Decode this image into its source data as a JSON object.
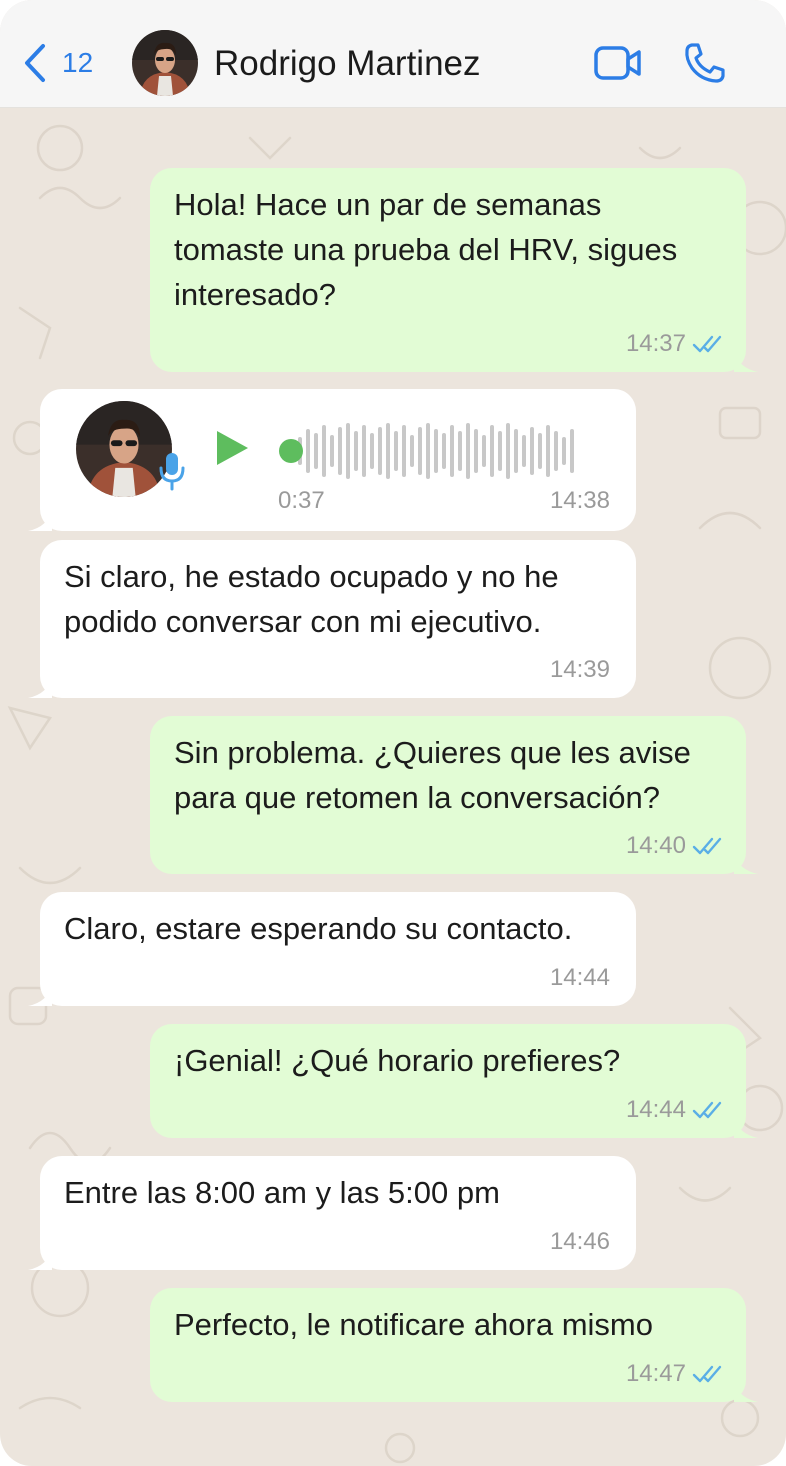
{
  "header": {
    "back_count": "12",
    "contact_name": "Rodrigo Martinez",
    "accent_color": "#2c7de6"
  },
  "colors": {
    "outgoing_bubble": "#e2fcd5",
    "incoming_bubble": "#ffffff",
    "chat_background": "#ece5dd",
    "read_ticks": "#5aaee6",
    "voice_green": "#5ebd5e"
  },
  "messages": [
    {
      "direction": "outgoing",
      "lines": [
        "Hola! Hace un par de semanas",
        "tomaste una prueba del HRV, sigues",
        "interesado?"
      ],
      "time": "14:37",
      "status_icon": "double-check-icon"
    },
    {
      "direction": "incoming",
      "type": "voice",
      "duration": "0:37",
      "time": "14:38",
      "icons": [
        "avatar",
        "microphone-icon",
        "play-icon",
        "waveform"
      ]
    },
    {
      "direction": "incoming",
      "lines": [
        "Si claro, he estado ocupado y no he",
        "podido conversar con mi ejecutivo."
      ],
      "time": "14:39"
    },
    {
      "direction": "outgoing",
      "lines": [
        "Sin problema. ¿Quieres que les avise",
        "para que retomen la conversación?"
      ],
      "time": "14:40",
      "status_icon": "double-check-icon"
    },
    {
      "direction": "incoming",
      "lines": [
        "Claro, estare esperando su contacto."
      ],
      "time": "14:44"
    },
    {
      "direction": "outgoing",
      "lines": [
        "¡Genial! ¿Qué horario prefieres?"
      ],
      "time": "14:44",
      "status_icon": "double-check-icon"
    },
    {
      "direction": "incoming",
      "lines": [
        "Entre las 8:00 am y las 5:00 pm"
      ],
      "time": "14:46"
    },
    {
      "direction": "outgoing",
      "lines": [
        "Perfecto, le notificare ahora mismo"
      ],
      "time": "14:47",
      "status_icon": "double-check-icon"
    }
  ]
}
